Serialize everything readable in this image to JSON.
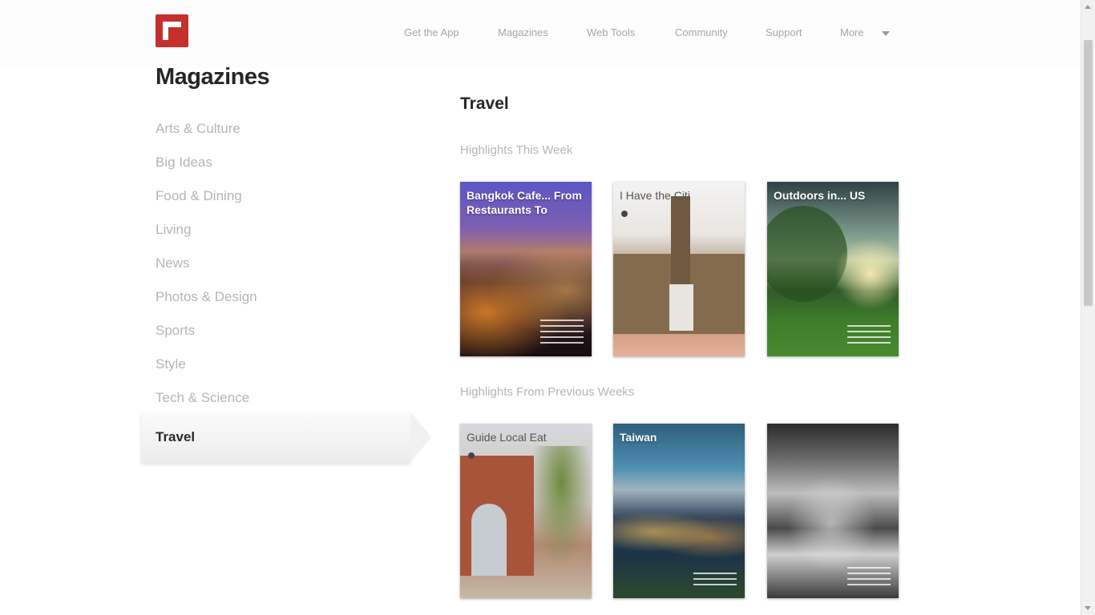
{
  "brand": {
    "logo_icon": "flipboard-logo-icon",
    "accent": "#c4302b"
  },
  "nav": {
    "items": [
      "Get the App",
      "Magazines",
      "Web Tools",
      "Community",
      "Support",
      "More"
    ],
    "more_icon": "chevron-down-icon"
  },
  "sidebar": {
    "title": "Magazines",
    "categories": [
      "Arts & Culture",
      "Big Ideas",
      "Food & Dining",
      "Living",
      "News",
      "Photos & Design",
      "Sports",
      "Style",
      "Tech & Science",
      "Travel"
    ],
    "active": "Travel"
  },
  "main": {
    "section_title": "Travel",
    "this_week_label": "Highlights This Week",
    "previous_label": "Highlights From Previous Weeks",
    "this_week": [
      {
        "title": "Bangkok Cafe... From Restaurants To"
      },
      {
        "title": "I Have the Citi"
      },
      {
        "title": "Outdoors in... US"
      }
    ],
    "previous": [
      {
        "title": "Guide Local Eat"
      },
      {
        "title": "Taiwan"
      },
      {
        "title": ""
      }
    ]
  },
  "colors": {
    "sidebar_text": "#b5b5b5",
    "active_text": "#2a2a2a",
    "nav_text": "#a6a6a6"
  }
}
